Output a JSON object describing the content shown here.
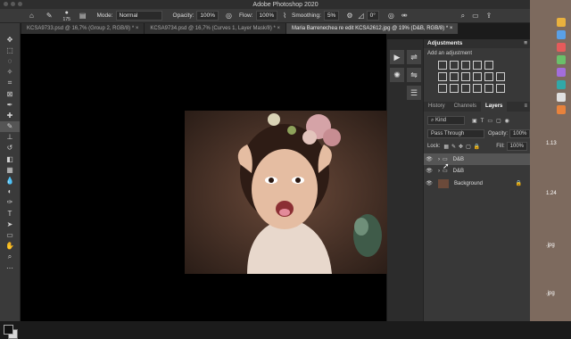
{
  "app": {
    "title": "Adobe Photoshop 2020"
  },
  "options": {
    "brush_size": "175",
    "mode_label": "Mode:",
    "mode_value": "Normal",
    "opacity_label": "Opacity:",
    "opacity_value": "100%",
    "flow_label": "Flow:",
    "flow_value": "100%",
    "smoothing_label": "Smoothing:",
    "smoothing_value": "5%",
    "angle_value": "0°"
  },
  "tabs": [
    {
      "label": "KCSA9733.psd @ 16,7% (Group 2, RGB/8) *"
    },
    {
      "label": "KCSA9734.psd @ 16,7% (Curves 1, Layer Mask/8) *"
    },
    {
      "label": "Maria Barrenechea re edit KCSA2612.jpg @ 19% (D&B, RGB/8) *"
    }
  ],
  "adjustments": {
    "title": "Adjustments",
    "subtitle": "Add an adjustment"
  },
  "layers_panel": {
    "tabs": [
      "History",
      "Channels",
      "Layers"
    ],
    "active_tab": "Layers",
    "filter_label": "Kind",
    "blend_mode": "Pass Through",
    "opacity_label": "Opacity:",
    "opacity_value": "100%",
    "lock_label": "Lock:",
    "fill_label": "Fill:",
    "fill_value": "100%",
    "layers": [
      {
        "name": "D&B",
        "type": "group",
        "selected": true
      },
      {
        "name": "D&B",
        "type": "group",
        "selected": false
      },
      {
        "name": "Background",
        "type": "image",
        "selected": false
      }
    ]
  },
  "desktop": {
    "labels": [
      "1.13",
      "1.24",
      ".jpg",
      ".jpg"
    ]
  },
  "colors": {
    "accent": "#3a3a3a",
    "canvas": "#000000",
    "panel": "#383838"
  }
}
